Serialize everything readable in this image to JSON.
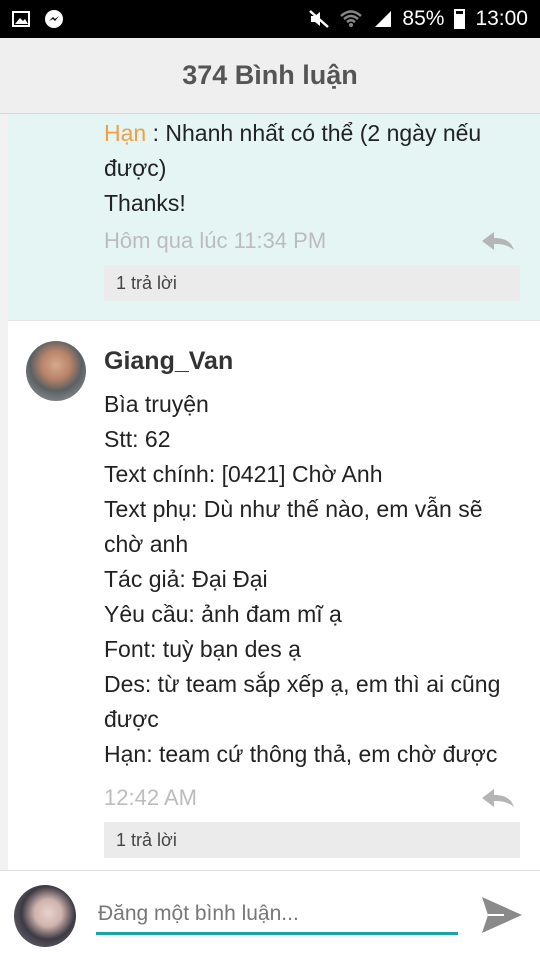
{
  "status_bar": {
    "battery": "85%",
    "time": "13:00",
    "icons": [
      "image-icon",
      "messenger-icon",
      "mute-icon",
      "wifi-icon",
      "signal-icon",
      "battery-icon"
    ]
  },
  "header": {
    "title": "374 Bình luận"
  },
  "comments": [
    {
      "name_inline": "Hạn",
      "lines": [
        " : Nhanh nhất có thể (2 ngày nếu",
        "được)",
        "Thanks!"
      ],
      "time": "Hôm qua lúc 11:34 PM",
      "reply_label": "1 trả lời"
    },
    {
      "username": "Giang_Van",
      "lines": [
        "Bìa truyện",
        "Stt: 62",
        "Text chính: [0421] Chờ Anh",
        "Text phụ: Dù như thế nào, em vẫn sẽ",
        "chờ anh",
        "Tác giả: Đại Đại",
        "Yêu cầu: ảnh đam mĩ ạ",
        "Font: tuỳ bạn des ạ",
        "Des: từ team sắp xếp ạ, em thì ai cũng",
        "được",
        "Hạn: team cứ thông thả, em chờ được"
      ],
      "time": "12:42 AM",
      "reply_label": "1 trả lời"
    }
  ],
  "input": {
    "placeholder": "Đăng một bình luận..."
  },
  "colors": {
    "accent": "#1aa3a0",
    "highlight_bg": "#e4f5f4",
    "name_orange": "#f0a040"
  }
}
